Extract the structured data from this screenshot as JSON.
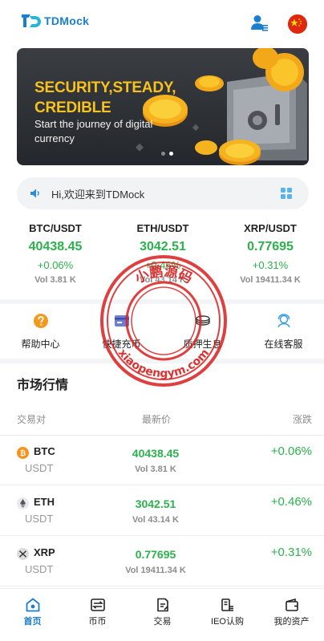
{
  "header": {
    "logo_text": "TDMock",
    "brand_color": "#1a7fd1",
    "user_icon": "user-profile-icon",
    "language_icon": "china-flag-icon"
  },
  "banner": {
    "title": "SECURITY,STEADY, CREDIBLE",
    "subtitle": "Start the journey of digital currency",
    "title_color": "#f7c21c",
    "slides": 2,
    "active_slide": 2
  },
  "notice": {
    "icon": "speaker-icon",
    "text": "Hi,欢迎来到TDMock",
    "more_icon": "grid-icon"
  },
  "tickers": [
    {
      "pair": "BTC/USDT",
      "price": "40438.45",
      "change": "+0.06%",
      "volume": "Vol 3.81 K"
    },
    {
      "pair": "ETH/USDT",
      "price": "3042.51",
      "change": "+0.46%",
      "volume": "Vol 43.14 K"
    },
    {
      "pair": "XRP/USDT",
      "price": "0.77695",
      "change": "+0.31%",
      "volume": "Vol 19411.34 K"
    }
  ],
  "quick_menu": [
    {
      "label": "帮助中心",
      "icon": "help-icon"
    },
    {
      "label": "快捷充币",
      "icon": "card-icon"
    },
    {
      "label": "质押生息",
      "icon": "coins-stack-icon"
    },
    {
      "label": "在线客服",
      "icon": "support-agent-icon"
    }
  ],
  "market": {
    "title": "市场行情",
    "columns": [
      "交易对",
      "最新价",
      "涨跌"
    ],
    "rows": [
      {
        "base": "BTC",
        "quote": "USDT",
        "price": "40438.45",
        "volume": "Vol 3.81 K",
        "change": "+0.06%",
        "icon": "btc-icon"
      },
      {
        "base": "ETH",
        "quote": "USDT",
        "price": "3042.51",
        "volume": "Vol 43.14 K",
        "change": "+0.46%",
        "icon": "eth-icon"
      },
      {
        "base": "XRP",
        "quote": "USDT",
        "price": "0.77695",
        "volume": "Vol 19411.34 K",
        "change": "+0.31%",
        "icon": "xrp-icon"
      }
    ],
    "up_color": "#2bb24c"
  },
  "watermark": {
    "top_text": "小鹏源码",
    "bottom_text": "xiaopengym.com",
    "color": "#d81e1e"
  },
  "tabbar": [
    {
      "label": "首页",
      "icon": "home-icon",
      "active": true
    },
    {
      "label": "币币",
      "icon": "exchange-icon",
      "active": false
    },
    {
      "label": "交易",
      "icon": "trade-icon",
      "active": false
    },
    {
      "label": "IEO认购",
      "icon": "ieo-icon",
      "active": false
    },
    {
      "label": "我的资产",
      "icon": "wallet-icon",
      "active": false
    }
  ]
}
